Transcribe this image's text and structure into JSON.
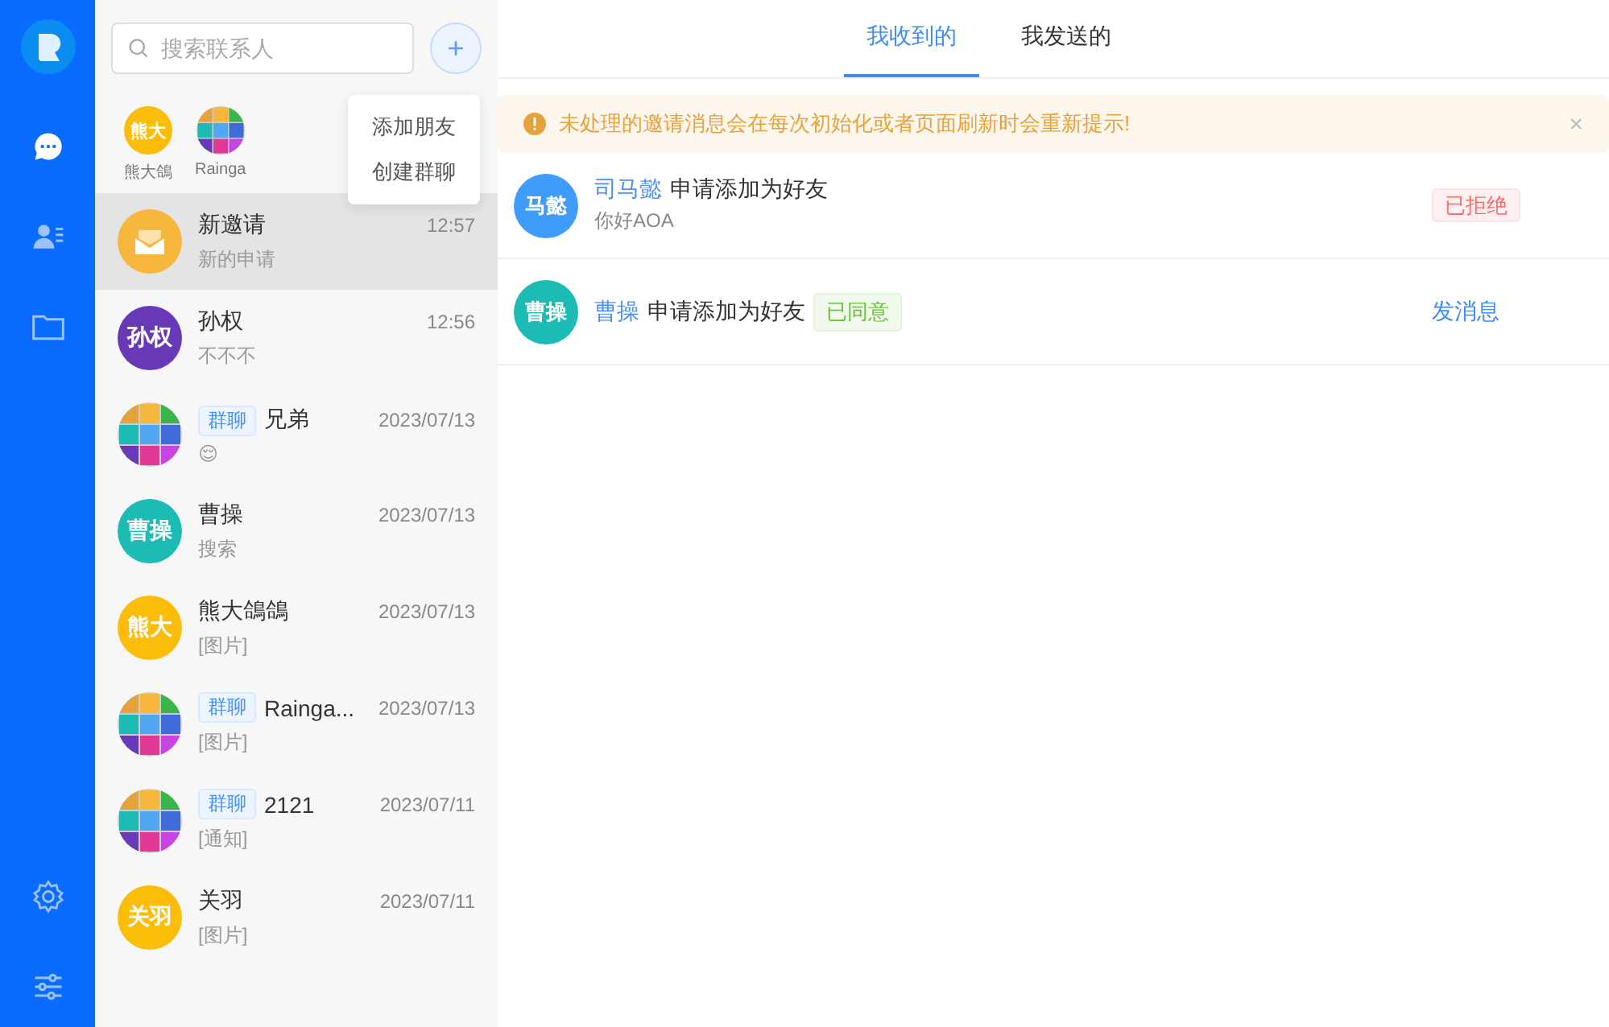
{
  "nav": {
    "items": [
      {
        "kind": "chat",
        "selected": true
      },
      {
        "kind": "contacts",
        "selected": false
      },
      {
        "kind": "folder",
        "selected": false
      }
    ],
    "bottom": [
      {
        "kind": "settings"
      },
      {
        "kind": "sliders"
      }
    ]
  },
  "search": {
    "placeholder": "搜索联系人"
  },
  "add_button": "+",
  "recent": [
    {
      "name": "熊大鴿",
      "kind": "person",
      "avatar": "熊大",
      "color": "#fbbd08"
    },
    {
      "name": "Rainga",
      "kind": "group"
    }
  ],
  "menu": [
    "添加朋友",
    "创建群聊"
  ],
  "conversations": [
    {
      "kind": "invite",
      "name": "新邀请",
      "preview": "新的申请",
      "time": "12:57",
      "selected": true,
      "color": "#f6b73c"
    },
    {
      "kind": "person",
      "avatar": "孙权",
      "name": "孙权",
      "preview": "不不不",
      "time": "12:56",
      "selected": false,
      "color": "#6739b6"
    },
    {
      "kind": "group",
      "tag": "群聊",
      "name": "兄弟",
      "preview": "😌",
      "time": "2023/07/13",
      "selected": false
    },
    {
      "kind": "person",
      "avatar": "曹操",
      "name": "曹操",
      "preview": "搜索",
      "time": "2023/07/13",
      "selected": false,
      "color": "#1cbbb4"
    },
    {
      "kind": "person",
      "avatar": "熊大",
      "name": "熊大鴿鴿",
      "preview": "[图片]",
      "time": "2023/07/13",
      "selected": false,
      "color": "#fbbd08"
    },
    {
      "kind": "group",
      "tag": "群聊",
      "name": "Rainga...",
      "preview": "[图片]",
      "time": "2023/07/13",
      "selected": false
    },
    {
      "kind": "group",
      "tag": "群聊",
      "name": "2121",
      "preview": "[通知]",
      "time": "2023/07/11",
      "selected": false
    },
    {
      "kind": "person",
      "avatar": "关羽",
      "name": "关羽",
      "preview": "[图片]",
      "time": "2023/07/11",
      "selected": false,
      "color": "#fbbd08"
    }
  ],
  "tabs": [
    {
      "label": "我收到的",
      "selected": true
    },
    {
      "label": "我发送的",
      "selected": false
    }
  ],
  "notice": {
    "text": "未处理的邀请消息会在每次初始化或者页面刷新时会重新提示!",
    "close": "×"
  },
  "requests": [
    {
      "avatar": "马懿",
      "color": "#3f9cfb",
      "name": "司马懿",
      "text": "申请添加为好友",
      "message": "你好AOA",
      "accepted": false,
      "status_label": "已拒绝"
    },
    {
      "avatar": "曹操",
      "color": "#1cbbb4",
      "name": "曹操",
      "text": "申请添加为好友",
      "accepted": true,
      "status_label": "已同意",
      "action": "发消息"
    }
  ]
}
